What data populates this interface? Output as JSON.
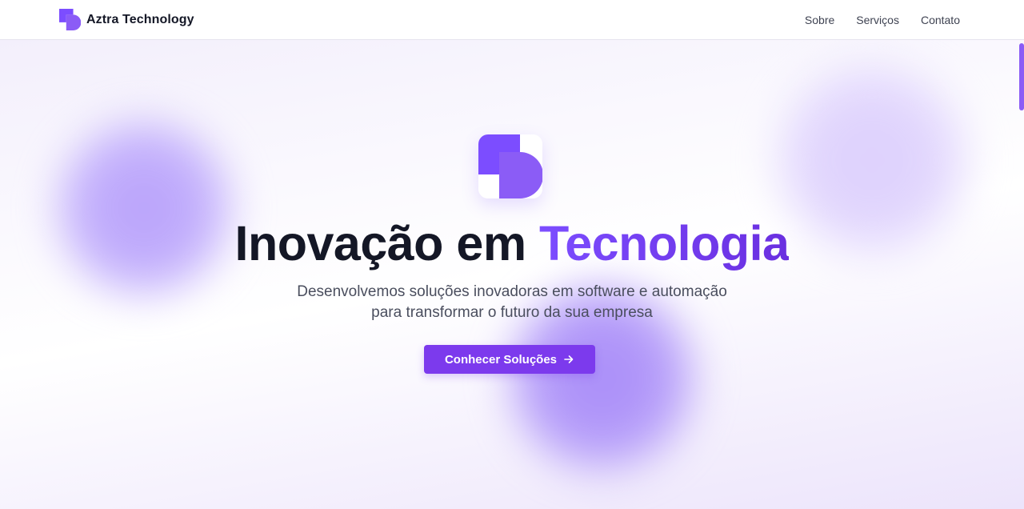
{
  "brand": {
    "name": "Aztra Technology",
    "logo_icon": "aztra-logo-icon",
    "accent_color": "#7c3aed"
  },
  "nav": {
    "items": [
      {
        "label": "Sobre"
      },
      {
        "label": "Serviços"
      },
      {
        "label": "Contato"
      }
    ]
  },
  "hero": {
    "logo_icon": "aztra-logo-icon",
    "title_main": "Inovação em ",
    "title_accent": "Tecnologia",
    "subtitle_line1": "Desenvolvemos soluções inovadoras em software e automação",
    "subtitle_line2": "para transformar o futuro da sua empresa",
    "cta_label": "Conhecer Soluções",
    "cta_icon": "arrow-right-icon"
  },
  "colors": {
    "accent": "#7c3aed",
    "title_text": "#141726",
    "subtitle_text": "#4a4e5e"
  }
}
